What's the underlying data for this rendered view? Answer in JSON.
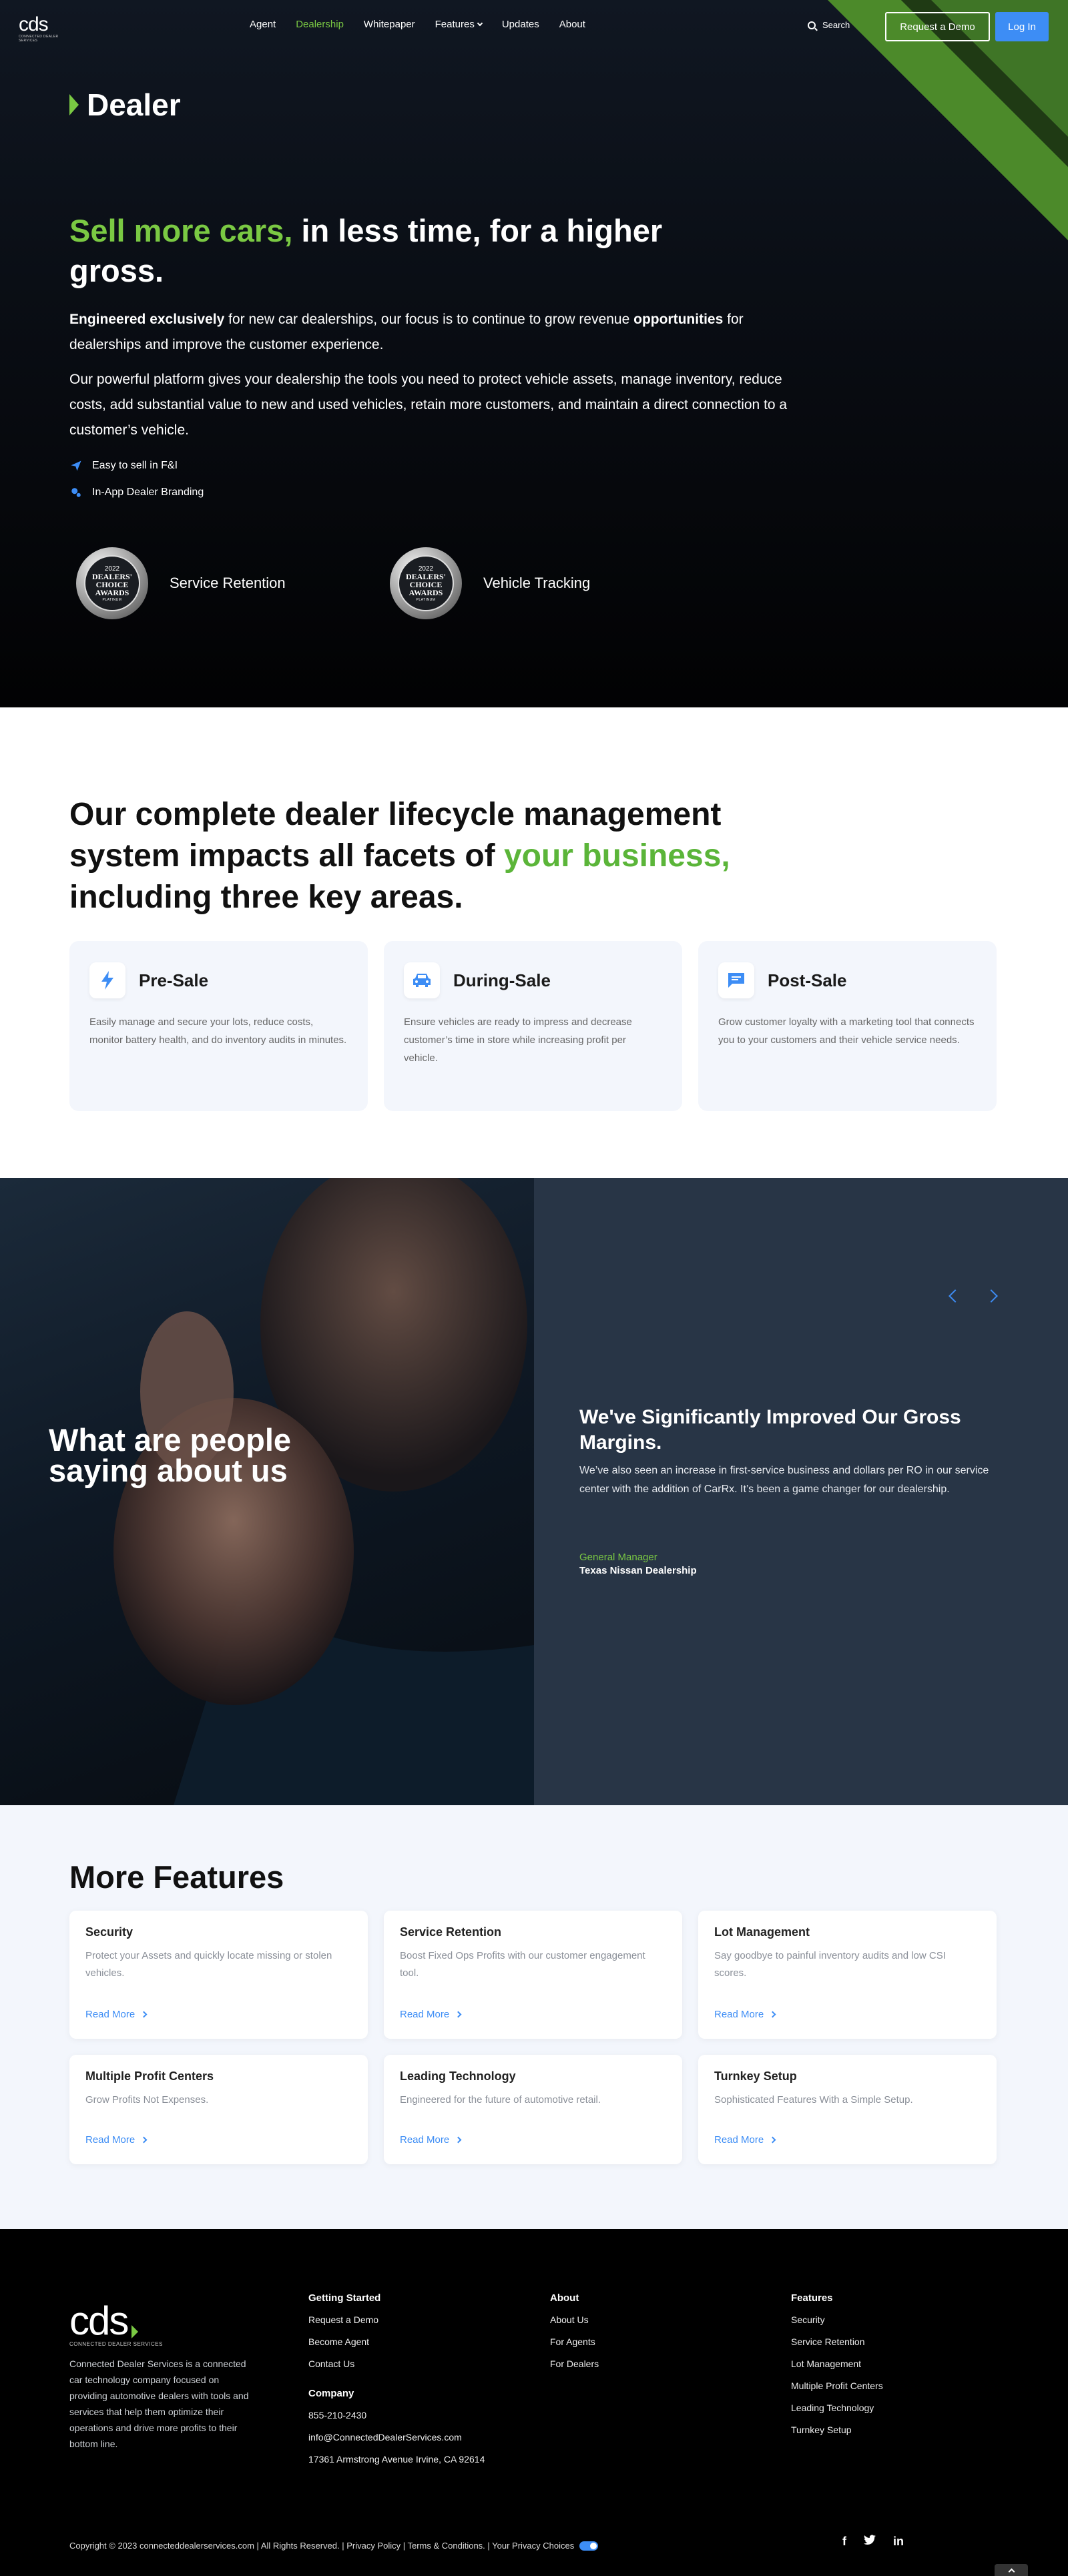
{
  "header": {
    "logo_text": "cds",
    "logo_tagline": "CONNECTED DEALER SERVICES",
    "nav": [
      {
        "label": "Agent"
      },
      {
        "label": "Dealership"
      },
      {
        "label": "Whitepaper"
      },
      {
        "label": "Features"
      },
      {
        "label": "Updates"
      },
      {
        "label": "About"
      }
    ],
    "search_label": "Search",
    "demo_button": "Request a Demo",
    "login_button": "Log In"
  },
  "hero": {
    "page_tag": "Dealer",
    "title_highlight": "Sell more cars,",
    "title_rest": " in less time, for a higher gross.",
    "p1_bold1": "Engineered exclusively",
    "p1_text1": " for new car dealerships, our focus is to continue to grow revenue ",
    "p1_bold2": "opportunities",
    "p1_text2": " for dealerships and improve the customer experience.",
    "p2": "Our powerful platform gives your dealership the tools you need to protect vehicle assets, manage inventory, reduce costs, add substantial value to new and used vehicles, retain more customers, and maintain a direct connection to a customer’s vehicle.",
    "features": [
      {
        "label": "Easy to sell in F&I",
        "icon": "paper-plane-icon"
      },
      {
        "label": "In-App Dealer Branding",
        "icon": "brand-icon"
      }
    ],
    "awards": [
      {
        "year": "2022",
        "badge_text": "DEALERS' CHOICE AWARDS",
        "sub": "PLATINUM",
        "label": "Service Retention"
      },
      {
        "year": "2022",
        "badge_text": "DEALERS' CHOICE AWARDS",
        "sub": "PLATINUM",
        "label": "Vehicle Tracking"
      }
    ],
    "accent": "#7ac943"
  },
  "lifecycle": {
    "heading_1": "Our complete dealer lifecycle management system impacts all facets of ",
    "heading_highlight": "your business,",
    "heading_2": " including three key areas.",
    "cards": [
      {
        "title": "Pre-Sale",
        "icon": "lightning-icon",
        "desc": "Easily manage and secure your lots, reduce costs, monitor battery health, and do inventory audits in minutes."
      },
      {
        "title": "During-Sale",
        "icon": "car-icon",
        "desc": "Ensure vehicles are ready to impress and decrease customer’s time in store while increasing profit per vehicle."
      },
      {
        "title": "Post-Sale",
        "icon": "chat-icon",
        "desc": "Grow customer loyalty with a marketing tool that connects you to your customers and their vehicle service needs."
      }
    ]
  },
  "testimonial": {
    "heading": "What are people saying about us",
    "quote_title": "We've Significantly Improved Our Gross Margins.",
    "quote_text": "We’ve also seen an increase in first-service business and dollars per RO in our service center with the addition of CarRx. It’s been a game changer for our dealership.",
    "role": "General Manager",
    "org": "Texas Nissan Dealership"
  },
  "more_features": {
    "heading": "More Features",
    "read_more": "Read More",
    "items": [
      {
        "title": "Security",
        "desc": "Protect your Assets and quickly locate missing or stolen vehicles."
      },
      {
        "title": "Service Retention",
        "desc": "Boost Fixed Ops Profits with our customer engagement tool."
      },
      {
        "title": "Lot Management",
        "desc": "Say goodbye to painful inventory audits and low CSI scores."
      },
      {
        "title": "Multiple Profit Centers",
        "desc": "Grow Profits Not Expenses."
      },
      {
        "title": "Leading Technology",
        "desc": "Engineered for the future of automotive retail."
      },
      {
        "title": "Turnkey Setup",
        "desc": "Sophisticated Features With a Simple Setup."
      }
    ]
  },
  "footer": {
    "logo_text": "cds",
    "logo_tagline": "CONNECTED DEALER SERVICES",
    "about_text": "Connected Dealer Services is a connected car technology company focused on providing automotive dealers with tools and services that help them optimize their operations and drive more profits to their bottom line.",
    "getting_started": {
      "title": "Getting Started",
      "links": [
        "Request a Demo",
        "Become Agent",
        "Contact Us"
      ]
    },
    "company": {
      "title": "Company",
      "phone": "855-210-2430",
      "email": "info@ConnectedDealerServices.com",
      "address": "17361 Armstrong Avenue Irvine, CA 92614"
    },
    "about": {
      "title": "About",
      "links": [
        "About Us",
        "For Agents",
        "For Dealers"
      ]
    },
    "features": {
      "title": "Features",
      "links": [
        "Security",
        "Service Retention",
        "Lot Management",
        "Multiple Profit Centers",
        "Leading Technology",
        "Turnkey Setup"
      ]
    },
    "copyright": "Copyright © 2023 connecteddealerservices.com | All Rights Reserved. | Privacy Policy | Terms & Conditions. | Your Privacy Choices",
    "socials": [
      "f",
      "t",
      "in"
    ]
  }
}
